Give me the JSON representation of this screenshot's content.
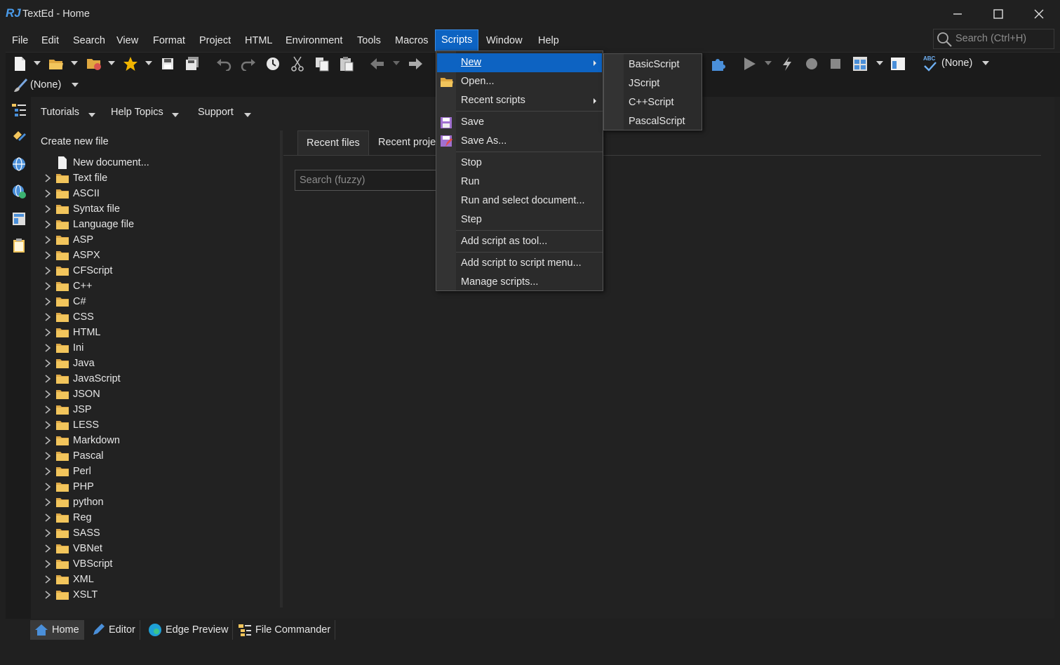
{
  "window": {
    "logo": "RJ",
    "title": "TextEd - Home"
  },
  "menubar": [
    "File",
    "Edit",
    "Search",
    "View",
    "Format",
    "Project",
    "HTML",
    "Environment",
    "Tools",
    "Macros",
    "Scripts",
    "Window",
    "Help"
  ],
  "search": {
    "placeholder": "Search (Ctrl+H)"
  },
  "toolbar": {
    "none_label_1": "(None)",
    "none_label_2": "(None)",
    "spell_label": "ABC"
  },
  "home_nav": {
    "tutorials": "Tutorials",
    "help_topics": "Help Topics",
    "support": "Support"
  },
  "create_new": {
    "title": "Create new file",
    "new_document": "New document...",
    "items": [
      "Text file",
      "ASCII",
      "Syntax file",
      "Language file",
      "ASP",
      "ASPX",
      "CFScript",
      "C++",
      "C#",
      "CSS",
      "HTML",
      "Ini",
      "Java",
      "JavaScript",
      "JSON",
      "JSP",
      "LESS",
      "Markdown",
      "Pascal",
      "Perl",
      "PHP",
      "python",
      "Reg",
      "SASS",
      "VBNet",
      "VBScript",
      "XML",
      "XSLT"
    ]
  },
  "tabs": {
    "recent_files": "Recent files",
    "recent_projects": "Recent proje"
  },
  "fuzzy_search": {
    "placeholder": "Search (fuzzy)"
  },
  "scripts_menu": {
    "new": "New",
    "open": "Open...",
    "recent": "Recent scripts",
    "save": "Save",
    "save_as": "Save As...",
    "stop": "Stop",
    "run": "Run",
    "run_select": "Run and select document...",
    "step": "Step",
    "add_tool": "Add script as tool...",
    "add_menu": "Add script to script menu...",
    "manage": "Manage scripts..."
  },
  "new_submenu": [
    "BasicScript",
    "JScript",
    "C++Script",
    "PascalScript"
  ],
  "bottom_tabs": {
    "home": "Home",
    "editor": "Editor",
    "edge": "Edge Preview",
    "commander": "File Commander"
  },
  "colors": {
    "accent": "#0d63c2",
    "folder": "#f2c55c",
    "background": "#202020"
  }
}
